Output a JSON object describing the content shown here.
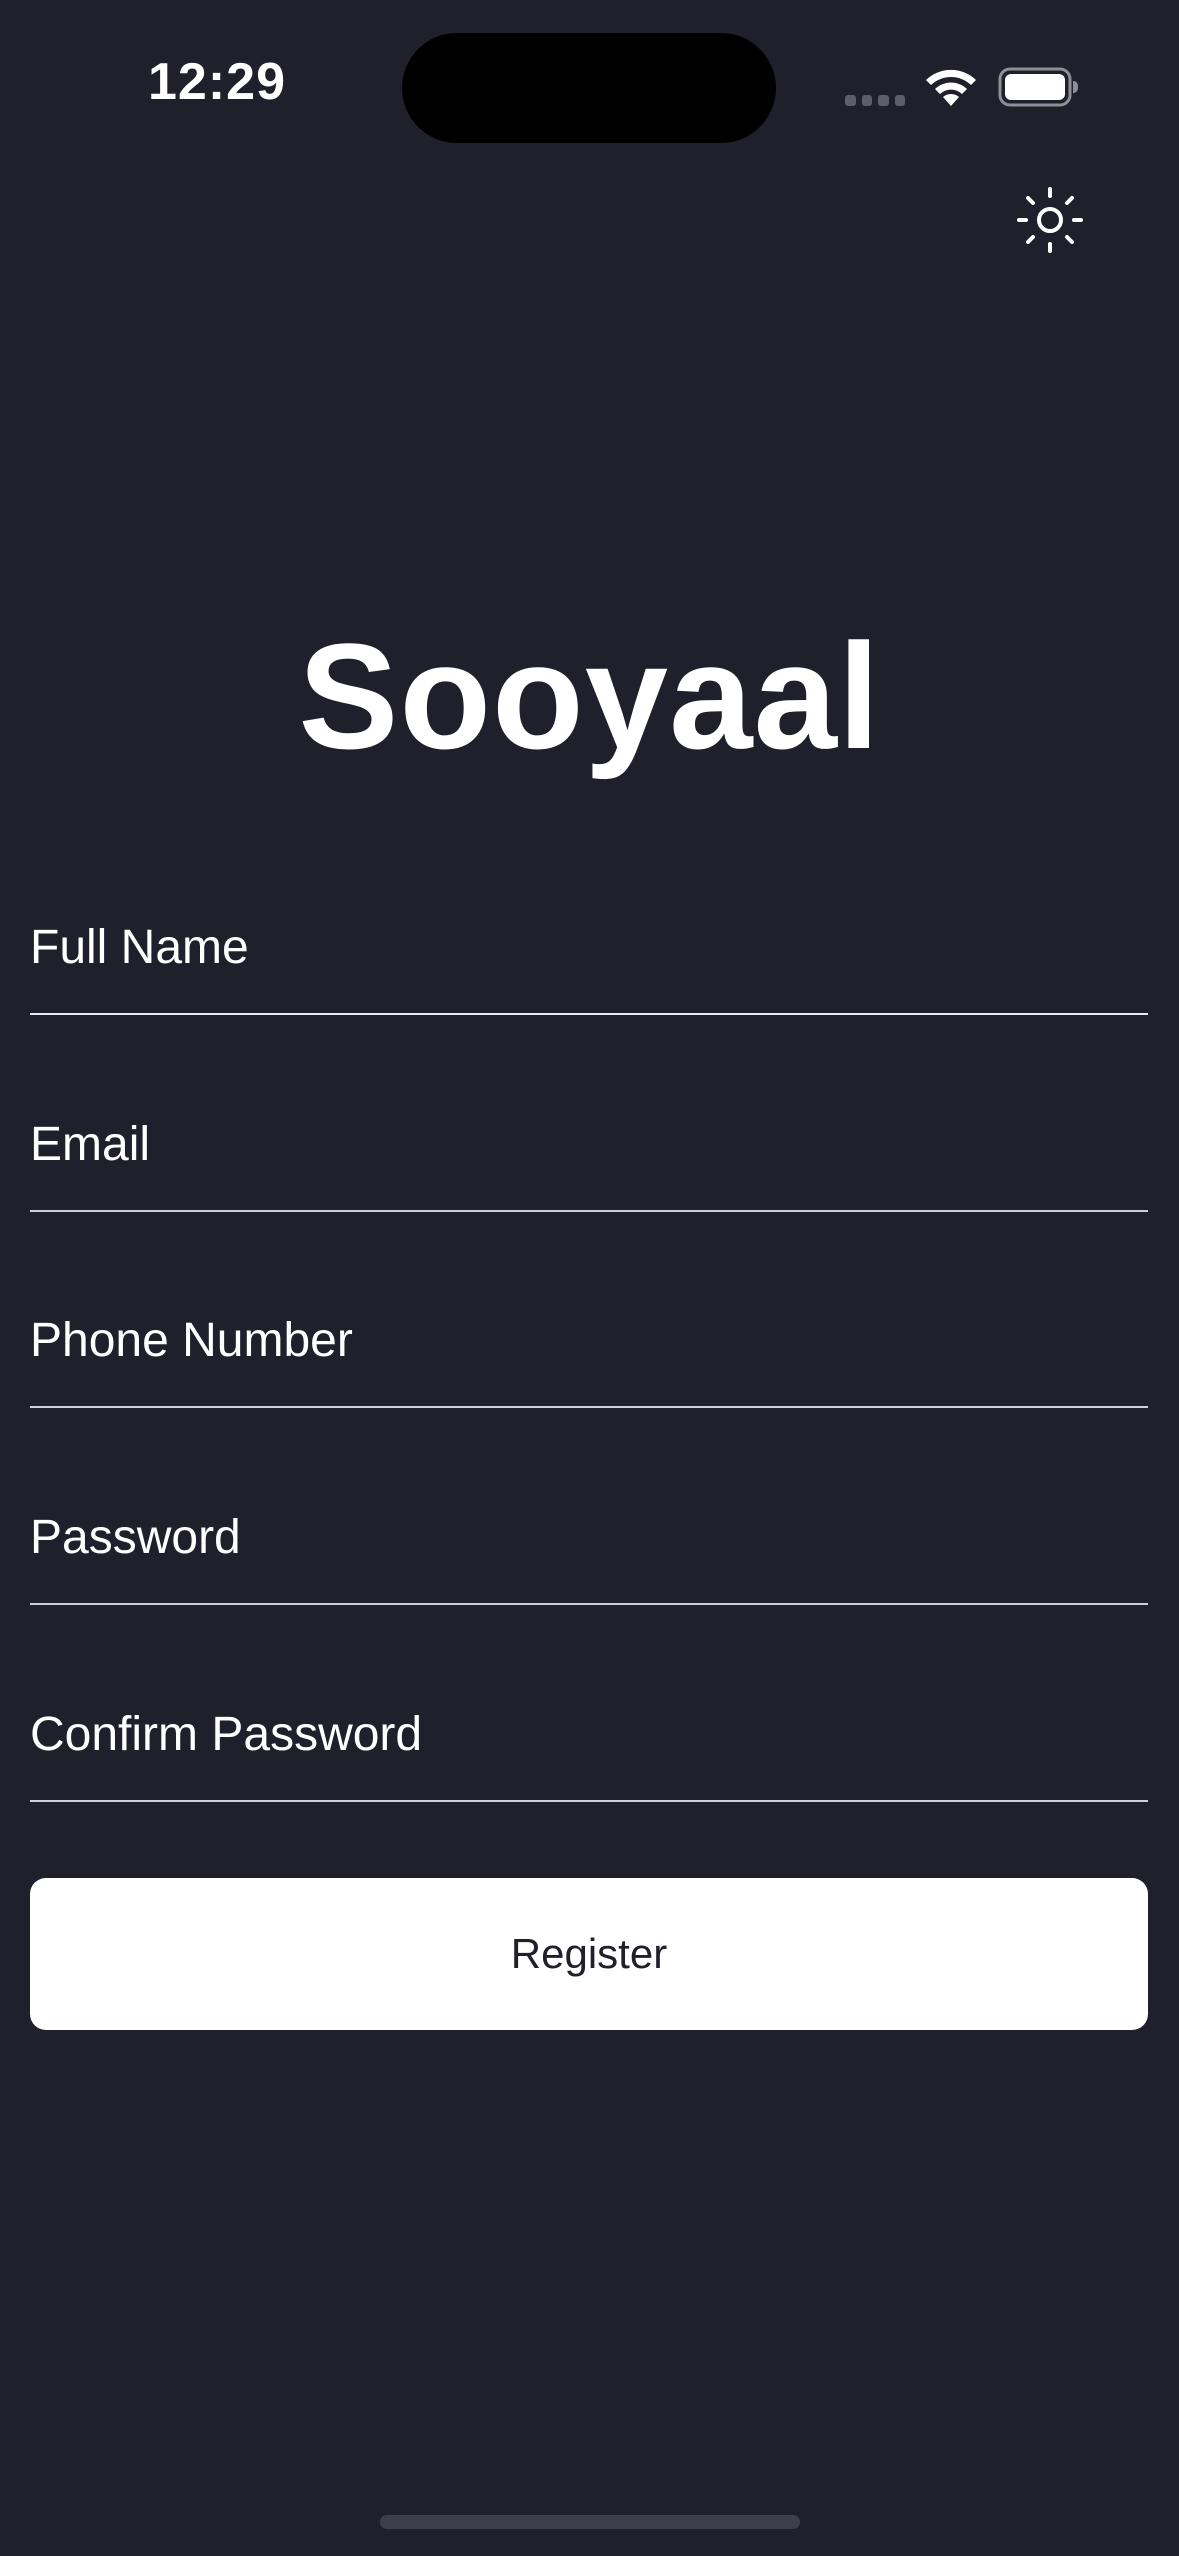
{
  "status_bar": {
    "time": "12:29"
  },
  "header": {
    "theme_toggle_icon": "sun-icon"
  },
  "app": {
    "title": "Sooyaal"
  },
  "form": {
    "full_name": {
      "placeholder": "Full Name",
      "value": ""
    },
    "email": {
      "placeholder": "Email",
      "value": ""
    },
    "phone": {
      "placeholder": "Phone Number",
      "value": ""
    },
    "password": {
      "placeholder": "Password",
      "value": ""
    },
    "confirm_password": {
      "placeholder": "Confirm Password",
      "value": ""
    },
    "register_label": "Register"
  },
  "colors": {
    "background": "#1f202b",
    "text": "#ffffff",
    "button_bg": "#ffffff",
    "button_text": "#1f202b"
  }
}
